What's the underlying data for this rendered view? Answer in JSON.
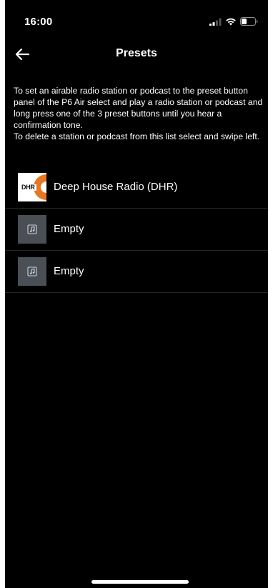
{
  "status_bar": {
    "time": "16:00",
    "icons": [
      "signal-icon",
      "wifi-icon",
      "battery-icon"
    ]
  },
  "nav": {
    "back_icon": "arrow-left-icon",
    "title": "Presets"
  },
  "instructions": {
    "line_set": "To set an airable radio station or podcast to the preset button panel of the P6 Air select and play a radio station or podcast and long press one of the 3 preset buttons until you hear a confirmation tone.",
    "line_delete": "To delete a station or podcast from this list select and swipe left."
  },
  "presets": [
    {
      "label": "Deep House Radio (DHR)",
      "thumb": "DHR",
      "thumb_icon": "dhr-logo"
    },
    {
      "label": "Empty",
      "thumb": "",
      "thumb_icon": "music-note-icon"
    },
    {
      "label": "Empty",
      "thumb": "",
      "thumb_icon": "music-note-icon"
    }
  ],
  "colors": {
    "background": "#000000",
    "text": "#ffffff",
    "divider": "#262626",
    "empty_thumb": "#4a4f56",
    "dhr_accent": "#e87722"
  }
}
